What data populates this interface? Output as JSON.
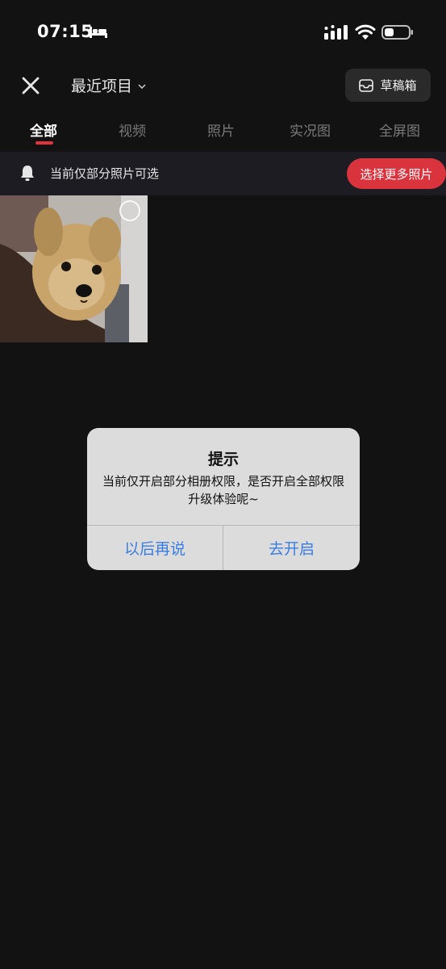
{
  "status_bar": {
    "time": "07:15"
  },
  "header": {
    "album_title": "最近项目",
    "drafts_label": "草稿箱"
  },
  "tabs": [
    {
      "label": "全部",
      "active": true
    },
    {
      "label": "视频"
    },
    {
      "label": "照片"
    },
    {
      "label": "实况图"
    },
    {
      "label": "全屏图"
    }
  ],
  "notice": {
    "text": "当前仅部分照片可选",
    "button_label": "选择更多照片"
  },
  "dialog": {
    "title": "提示",
    "message": "当前仅开启部分相册权限，是否开启全部权限升级体验呢~",
    "cancel_label": "以后再说",
    "confirm_label": "去开启"
  },
  "colors": {
    "accent": "#d9343e",
    "dialog_button": "#3a7de0",
    "background": "#121212"
  },
  "icons": [
    "bed-icon",
    "signal-icon",
    "wifi-icon",
    "battery-icon",
    "close-icon",
    "chevron-down-icon",
    "inbox-icon",
    "bell-icon"
  ]
}
